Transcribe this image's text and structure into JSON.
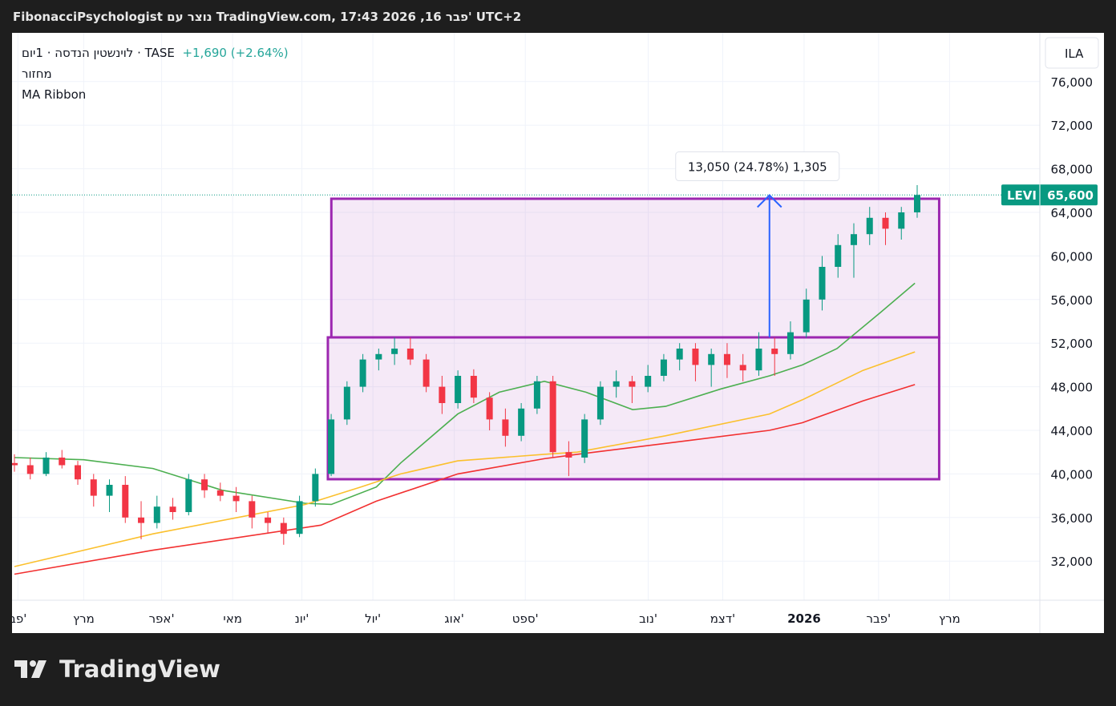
{
  "header": {
    "title": "FibonacciPsychologist נוצר עם TradingView.com, 17:43 2026 ,16 פבר' UTC+2"
  },
  "legend": {
    "symbol": "לוינשטין הנדסה · 1יום · TASE",
    "change": "+1,690 (+2.64%)",
    "ind1": "מחזור",
    "ind2": "MA Ribbon"
  },
  "currency": "ILA",
  "last": {
    "ticker": "LEVI",
    "price": "65,600"
  },
  "measure": {
    "label": "13,050 (24.78%) 1,305"
  },
  "brand": "TradingView",
  "chart_data": {
    "type": "candlestick",
    "ylim": [
      29000,
      79000
    ],
    "yticks": [
      32000,
      36000,
      40000,
      44000,
      48000,
      52000,
      56000,
      60000,
      64000,
      68000,
      72000,
      76000
    ],
    "ytick_labels": [
      "32,000",
      "36,000",
      "40,000",
      "44,000",
      "48,000",
      "52,000",
      "56,000",
      "60,000",
      "64,000",
      "68,000",
      "72,000",
      "76,000"
    ],
    "xticks": [
      {
        "w": 0.2,
        "label": "פב'"
      },
      {
        "w": 4,
        "label": "מרץ"
      },
      {
        "w": 8.5,
        "label": "אפר'"
      },
      {
        "w": 12.6,
        "label": "מאי"
      },
      {
        "w": 16.6,
        "label": "יונ'"
      },
      {
        "w": 20.7,
        "label": "יול'"
      },
      {
        "w": 25.4,
        "label": "אוג'"
      },
      {
        "w": 29.5,
        "label": "ספט'"
      },
      {
        "w": 36.6,
        "label": "נוב'"
      },
      {
        "w": 40.9,
        "label": "דצמ'"
      },
      {
        "w": 45.6,
        "label": "2026"
      },
      {
        "w": 49.9,
        "label": "פבר'"
      },
      {
        "w": 54,
        "label": "מרץ"
      }
    ],
    "candles": [
      [
        41000,
        41800,
        40200,
        40800
      ],
      [
        40800,
        41500,
        39500,
        40000
      ],
      [
        40000,
        42000,
        39800,
        41500
      ],
      [
        41500,
        42200,
        40500,
        40800
      ],
      [
        40800,
        41200,
        39000,
        39500
      ],
      [
        39500,
        40000,
        37000,
        38000
      ],
      [
        38000,
        39500,
        36500,
        39000
      ],
      [
        39000,
        39800,
        35500,
        36000
      ],
      [
        36000,
        37500,
        34000,
        35500
      ],
      [
        35500,
        38000,
        35000,
        37000
      ],
      [
        37000,
        37800,
        35800,
        36500
      ],
      [
        36500,
        40000,
        36200,
        39500
      ],
      [
        39500,
        40000,
        37800,
        38500
      ],
      [
        38500,
        39200,
        37500,
        38000
      ],
      [
        38000,
        38800,
        36500,
        37500
      ],
      [
        37500,
        38000,
        35000,
        36000
      ],
      [
        36000,
        36500,
        34500,
        35500
      ],
      [
        35500,
        36000,
        33500,
        34500
      ],
      [
        34500,
        38000,
        34200,
        37500
      ],
      [
        37500,
        40500,
        37000,
        40000
      ],
      [
        40000,
        45500,
        39800,
        45000
      ],
      [
        45000,
        48500,
        44500,
        48000
      ],
      [
        48000,
        51000,
        47500,
        50500
      ],
      [
        50500,
        51500,
        49500,
        51000
      ],
      [
        51000,
        52500,
        50000,
        51500
      ],
      [
        51500,
        52500,
        50000,
        50500
      ],
      [
        50500,
        51000,
        47500,
        48000
      ],
      [
        48000,
        49000,
        45500,
        46500
      ],
      [
        46500,
        49500,
        46000,
        49000
      ],
      [
        49000,
        49600,
        46500,
        47000
      ],
      [
        47000,
        47500,
        44000,
        45000
      ],
      [
        45000,
        46000,
        42500,
        43500
      ],
      [
        43500,
        46500,
        43000,
        46000
      ],
      [
        46000,
        49000,
        45500,
        48500
      ],
      [
        48500,
        49000,
        41500,
        42000
      ],
      [
        42000,
        43000,
        39800,
        41500
      ],
      [
        41500,
        45500,
        41000,
        45000
      ],
      [
        45000,
        48500,
        44500,
        48000
      ],
      [
        48000,
        49500,
        47000,
        48500
      ],
      [
        48500,
        49000,
        46500,
        48000
      ],
      [
        48000,
        50000,
        47500,
        49000
      ],
      [
        49000,
        51000,
        48500,
        50500
      ],
      [
        50500,
        52000,
        49500,
        51500
      ],
      [
        51500,
        52000,
        48500,
        50000
      ],
      [
        50000,
        51500,
        48000,
        51000
      ],
      [
        51000,
        52000,
        48800,
        50000
      ],
      [
        50000,
        51000,
        48500,
        49500
      ],
      [
        49500,
        53000,
        49000,
        51500
      ],
      [
        51500,
        52500,
        49000,
        51000
      ],
      [
        51000,
        54000,
        50500,
        53000
      ],
      [
        53000,
        57000,
        52500,
        56000
      ],
      [
        56000,
        60000,
        55000,
        59000
      ],
      [
        59000,
        62000,
        58000,
        61000
      ],
      [
        61000,
        63000,
        58000,
        62000
      ],
      [
        62000,
        64500,
        61000,
        63500
      ],
      [
        63500,
        64000,
        61000,
        62500
      ],
      [
        62500,
        64500,
        61500,
        64000
      ],
      [
        64000,
        66500,
        63500,
        65600
      ]
    ],
    "series": [
      {
        "name": "MA short",
        "color": "#4caf50",
        "points": [
          [
            0,
            41500
          ],
          [
            4,
            41300
          ],
          [
            8,
            40500
          ],
          [
            12,
            38500
          ],
          [
            16.8,
            37300
          ],
          [
            18.3,
            37200
          ],
          [
            20.9,
            38800
          ],
          [
            22.3,
            41000
          ],
          [
            25.6,
            45500
          ],
          [
            28,
            47500
          ],
          [
            30.6,
            48500
          ],
          [
            33,
            47500
          ],
          [
            35.7,
            45900
          ],
          [
            37.6,
            46200
          ],
          [
            40.8,
            47800
          ],
          [
            43.6,
            49000
          ],
          [
            45.5,
            50000
          ],
          [
            47.5,
            51500
          ],
          [
            50,
            54800
          ],
          [
            52,
            57500
          ]
        ]
      },
      {
        "name": "MA mid",
        "color": "#fbc02d",
        "points": [
          [
            0,
            31500
          ],
          [
            8,
            34500
          ],
          [
            16.8,
            37200
          ],
          [
            20,
            38800
          ],
          [
            22.3,
            40000
          ],
          [
            25.6,
            41200
          ],
          [
            30.6,
            41800
          ],
          [
            32.5,
            42000
          ],
          [
            37.6,
            43500
          ],
          [
            43.6,
            45500
          ],
          [
            45.5,
            46800
          ],
          [
            49,
            49500
          ],
          [
            52,
            51200
          ]
        ]
      },
      {
        "name": "MA long",
        "color": "#f23030",
        "points": [
          [
            0,
            30800
          ],
          [
            8,
            33000
          ],
          [
            17.7,
            35300
          ],
          [
            20.9,
            37500
          ],
          [
            25.6,
            40000
          ],
          [
            30.6,
            41400
          ],
          [
            32.5,
            41800
          ],
          [
            37.6,
            42800
          ],
          [
            43.6,
            44000
          ],
          [
            45.5,
            44700
          ],
          [
            49,
            46700
          ],
          [
            52,
            48200
          ]
        ]
      }
    ],
    "boxes": [
      {
        "w0": 18.3,
        "w1": 53.4,
        "p0": 52530,
        "p1": 65250
      },
      {
        "w0": 18.1,
        "w1": 53.4,
        "p0": 39515,
        "p1": 52530
      }
    ],
    "measure_arrow": {
      "w": 43.6,
      "from": 52530,
      "to": 65580
    }
  }
}
